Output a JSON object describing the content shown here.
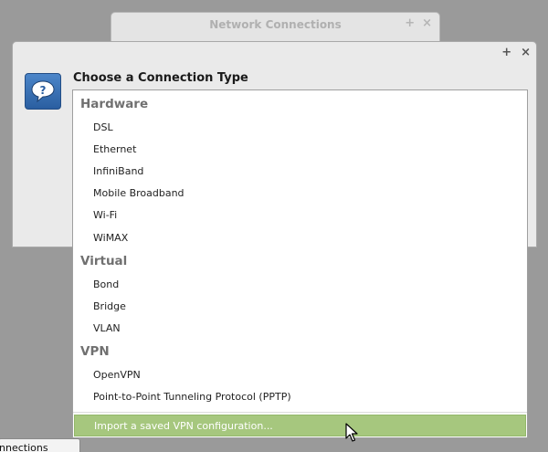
{
  "bg_window": {
    "title": "Network Connections",
    "add": "+",
    "close": "×"
  },
  "dialog": {
    "add": "+",
    "close": "×",
    "heading": "Choose a Connection Type",
    "icon": "question-icon"
  },
  "list": {
    "sections": [
      {
        "header": "Hardware",
        "items": [
          "DSL",
          "Ethernet",
          "InfiniBand",
          "Mobile Broadband",
          "Wi-Fi",
          "WiMAX"
        ]
      },
      {
        "header": "Virtual",
        "items": [
          "Bond",
          "Bridge",
          "VLAN"
        ]
      },
      {
        "header": "VPN",
        "items": [
          "OpenVPN",
          "Point-to-Point Tunneling Protocol (PPTP)"
        ]
      }
    ],
    "import_label": "Import a saved VPN configuration..."
  },
  "taskbar": {
    "label": "nnections"
  },
  "colors": {
    "highlight": "#a6c77e",
    "icon_blue": "#3a72b8"
  }
}
